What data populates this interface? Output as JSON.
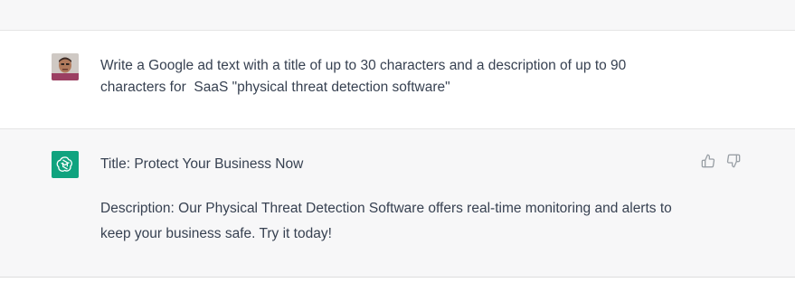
{
  "user_message": {
    "text": "Write a Google ad text with a title of up to 30 characters and a description of up to 90 characters for  SaaS \"physical threat detection software\""
  },
  "assistant_message": {
    "title_line": "Title: Protect Your Business Now",
    "description_line": "Description: Our Physical Threat Detection Software offers real-time monitoring and alerts to keep your business safe. Try it today!"
  },
  "icons": {
    "avatar": "user-avatar",
    "assistant": "openai-logo-icon",
    "like": "thumbs-up-icon",
    "dislike": "thumbs-down-icon"
  },
  "colors": {
    "assistant_logo_bg": "#10a37f",
    "text": "#374151",
    "assistant_bg": "#f7f7f8",
    "user_bg": "#ffffff"
  }
}
